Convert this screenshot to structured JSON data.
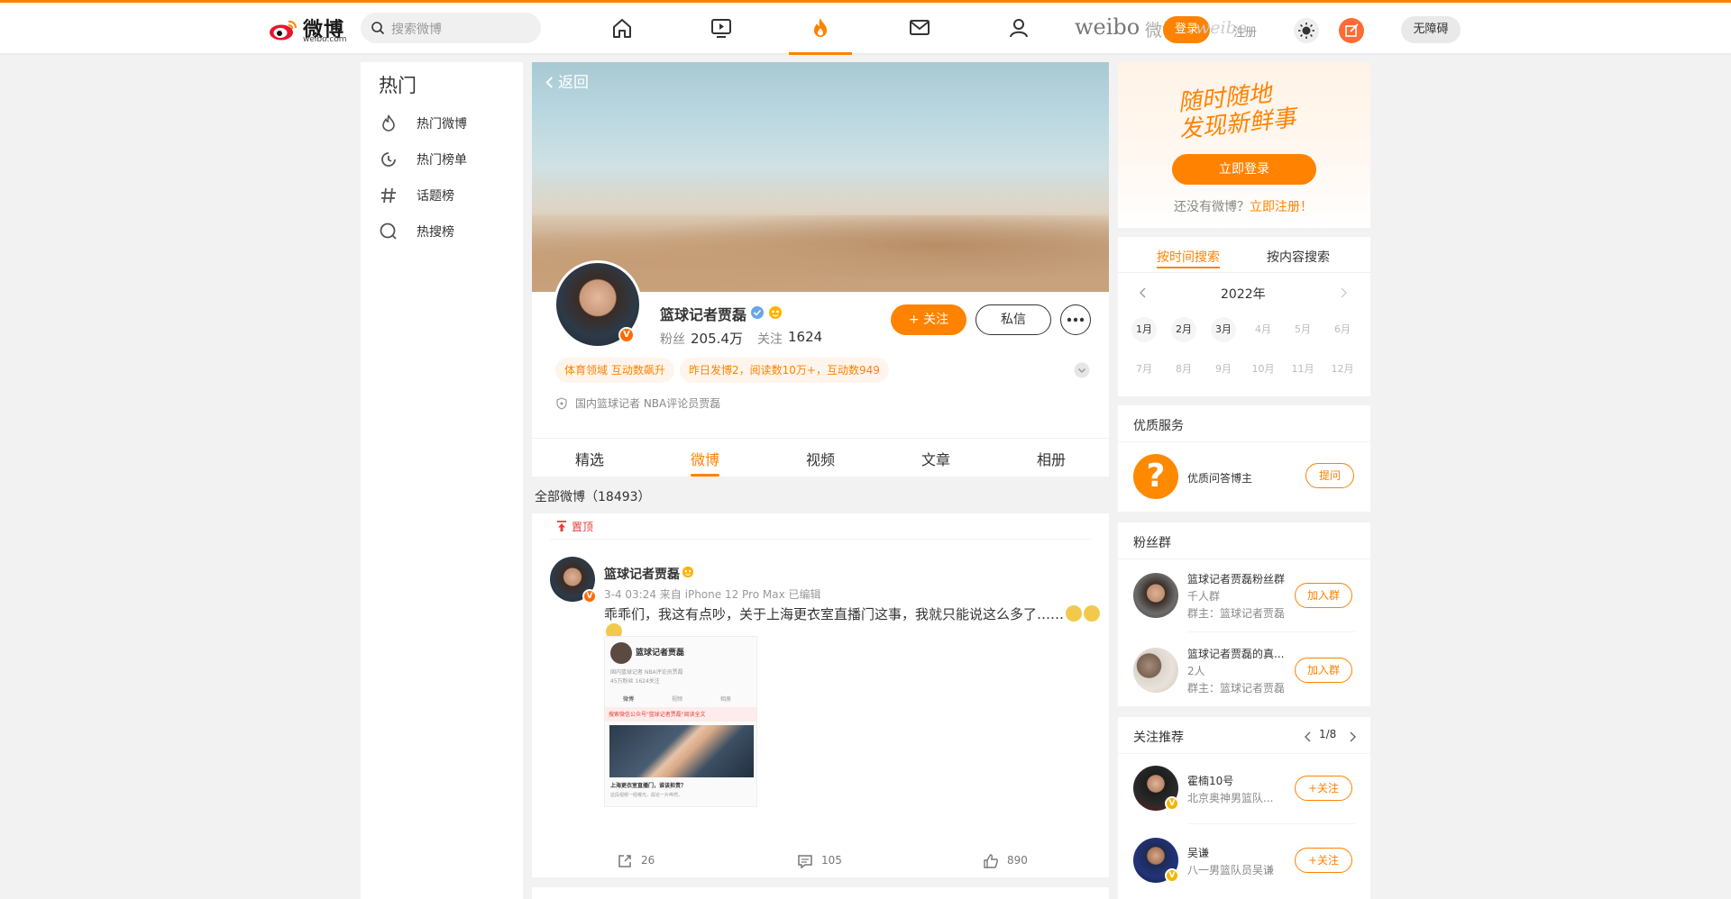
{
  "header": {
    "logo_cn": "微博",
    "logo_en": "weibo.com",
    "search_placeholder": "搜索微博",
    "brand_word": "weibo",
    "brand_word_cn": "微博",
    "login_label": "登录",
    "brand_ghost": "weibo",
    "register_label": "注册",
    "accessibility_label": "无障碍"
  },
  "left_nav": {
    "title": "热门",
    "items": [
      {
        "label": "热门微博",
        "icon": "flame-icon"
      },
      {
        "label": "热门榜单",
        "icon": "clock-icon"
      },
      {
        "label": "话题榜",
        "icon": "hashtag-icon"
      },
      {
        "label": "热搜榜",
        "icon": "search-icon"
      }
    ]
  },
  "profile": {
    "back_label": "返回",
    "name": "篮球记者贾磊",
    "fans_label": "粉丝",
    "fans_value": "205.4万",
    "follow_label": "关注",
    "follow_value": "1624",
    "follow_button": "+ 关注",
    "message_button": "私信",
    "tags": [
      "体育领域 互动数飙升",
      "昨日发博2，阅读数10万+，互动数949"
    ],
    "bio": "国内篮球记者 NBA评论员贾磊"
  },
  "tabs": [
    "精选",
    "微博",
    "视频",
    "文章",
    "相册"
  ],
  "active_tab": "微博",
  "feed": {
    "count_label": "全部微博（18493）"
  },
  "post": {
    "pinned_label": "置顶",
    "author": "篮球记者贾磊",
    "meta": "3-4 03:24  来自 iPhone 12 Pro Max 已编辑",
    "text": "乖乖们，我这有点吵，关于上海更衣室直播门这事，我就只能说这么多了……",
    "image": {
      "name": "篮球记者贾磊",
      "line1": "国内篮球记者 NBA评论员贾磊",
      "line2": "45万粉丝 1624关注",
      "tabs": [
        "微博",
        "视频",
        "相册"
      ],
      "banner": "搜索微信公众号\"篮球记者贾磊\"阅读全文",
      "caption_title": "上海更衣室直播门，谁该担责？",
      "caption_body": "这段视频一经曝光，舆论一片哗然。"
    },
    "reposts": "26",
    "comments": "105",
    "likes": "890"
  },
  "sidebar": {
    "slogan_line1": "随时随地",
    "slogan_line2": "发现新鲜事",
    "login_button": "立即登录",
    "no_account": "还没有微博？",
    "register_now": "立即注册！",
    "search_tabs": [
      "按时间搜索",
      "按内容搜索"
    ],
    "year": "2022年",
    "months": [
      "1月",
      "2月",
      "3月",
      "4月",
      "5月",
      "6月",
      "7月",
      "8月",
      "9月",
      "10月",
      "11月",
      "12月"
    ],
    "service_title": "优质服务",
    "service_name": "优质问答博主",
    "ask_button": "提问",
    "fans_title": "粉丝群",
    "groups": [
      {
        "name": "篮球记者贾磊粉丝群",
        "size": "千人群",
        "owner": "群主：篮球记者贾磊",
        "button": "加入群"
      },
      {
        "name": "篮球记者贾磊的真...",
        "size": "2人",
        "owner": "群主：篮球记者贾磊",
        "button": "加入群"
      }
    ],
    "rec_title": "关注推荐",
    "rec_page": "1/8",
    "recs": [
      {
        "name": "霍楠10号",
        "desc": "北京奥神男篮队...",
        "button": "+关注"
      },
      {
        "name": "吴谦",
        "desc": "八一男篮队员吴谦",
        "button": "+关注"
      }
    ]
  },
  "colors": {
    "accent": "#ff8200",
    "pinned": "#e0413a",
    "verified": "#ff6a00"
  }
}
